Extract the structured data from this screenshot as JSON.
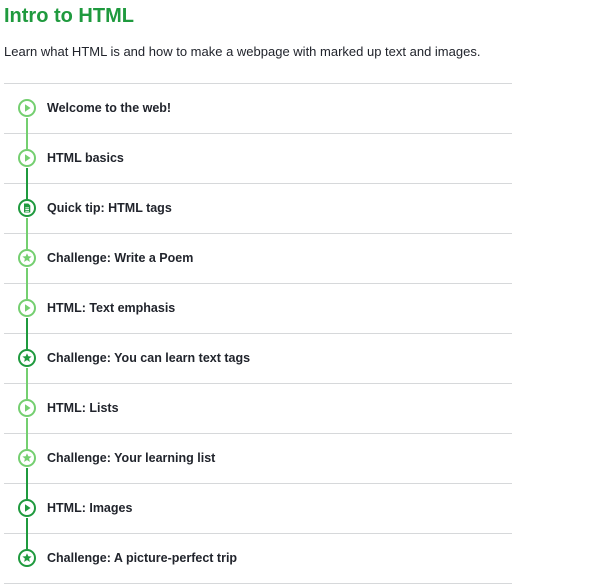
{
  "course": {
    "title": "Intro to HTML",
    "description": "Learn what HTML is and how to make a webpage with marked up text and images."
  },
  "colors": {
    "title": "#1f9a3e",
    "light_green": "#74cf70",
    "dark_green": "#1f9a3e",
    "divider": "#d6d8da"
  },
  "items": [
    {
      "label": "Welcome to the web!",
      "icon": "play-icon",
      "dark": false
    },
    {
      "label": "HTML basics",
      "icon": "play-icon",
      "dark": false
    },
    {
      "label": "Quick tip: HTML tags",
      "icon": "document-icon",
      "dark": true
    },
    {
      "label": "Challenge: Write a Poem",
      "icon": "star-icon",
      "dark": false
    },
    {
      "label": "HTML: Text emphasis",
      "icon": "play-icon",
      "dark": false
    },
    {
      "label": "Challenge: You can learn text tags",
      "icon": "star-icon",
      "dark": true
    },
    {
      "label": "HTML: Lists",
      "icon": "play-icon",
      "dark": false
    },
    {
      "label": "Challenge: Your learning list",
      "icon": "star-icon",
      "dark": false
    },
    {
      "label": "HTML: Images",
      "icon": "play-icon",
      "dark": true
    },
    {
      "label": "Challenge: A picture-perfect trip",
      "icon": "star-icon",
      "dark": true
    }
  ]
}
